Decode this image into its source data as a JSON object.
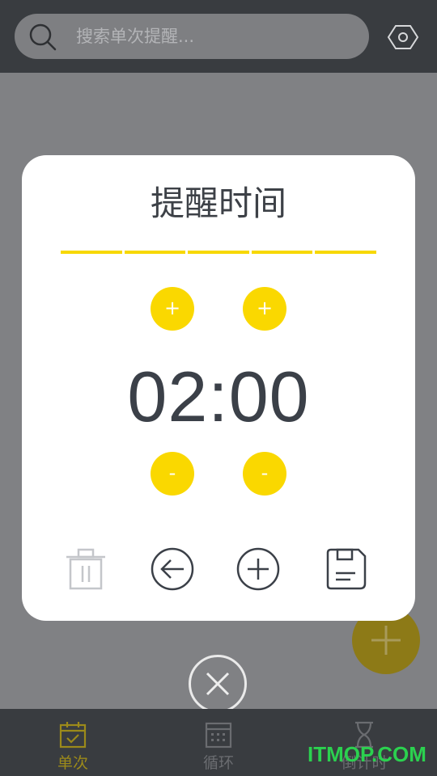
{
  "search": {
    "placeholder": "搜索单次提醒..."
  },
  "dialog": {
    "title": "提醒时间",
    "time": "02:00",
    "hour_plus": "+",
    "minute_plus": "+",
    "hour_minus": "-",
    "minute_minus": "-"
  },
  "tabs": [
    {
      "label": "单次",
      "icon": "calendar-check-icon",
      "active": true
    },
    {
      "label": "循环",
      "icon": "calendar-grid-icon",
      "active": false
    },
    {
      "label": "倒计时",
      "icon": "hourglass-icon",
      "active": false
    }
  ],
  "watermark": "ITMOP.COM",
  "colors": {
    "accent": "#F7D800",
    "topbar": "#393C40",
    "text": "#3B4048"
  }
}
